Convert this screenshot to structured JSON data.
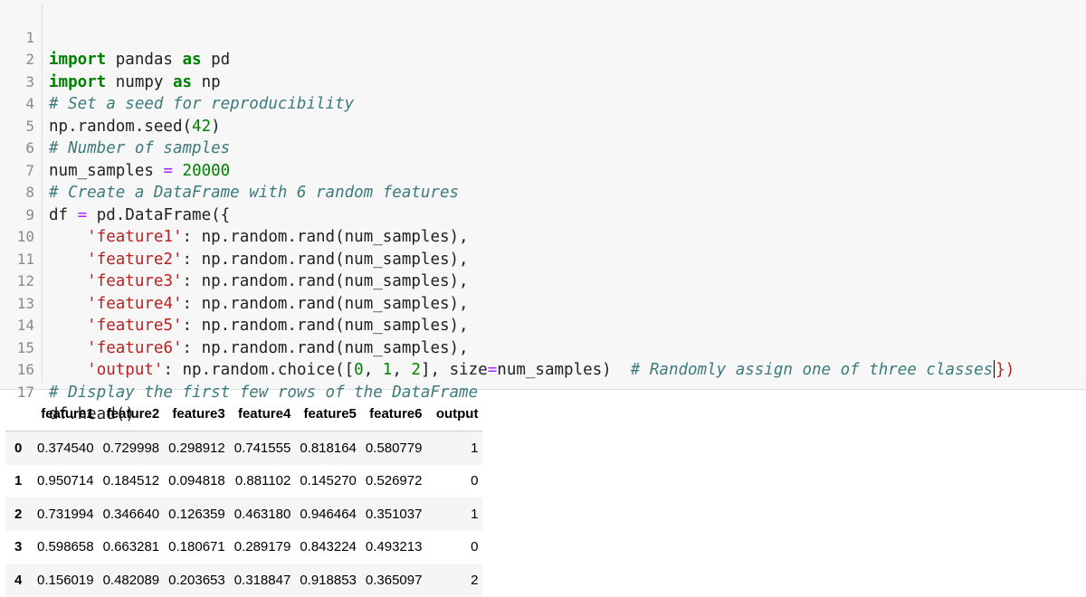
{
  "code_cell": {
    "line_numbers": [
      "1",
      "2",
      "3",
      "4",
      "5",
      "6",
      "7",
      "8",
      "9",
      "10",
      "11",
      "12",
      "13",
      "14",
      "15",
      "16",
      "17"
    ],
    "l1": {
      "kw1": "import",
      "t1": " pandas ",
      "kw2": "as",
      "t2": " pd"
    },
    "l2": {
      "kw1": "import",
      "t1": " numpy ",
      "kw2": "as",
      "t2": " np"
    },
    "l3": {
      "comment": "# Set a seed for reproducibility"
    },
    "l4": {
      "t1": "np.random.seed(",
      "num": "42",
      "t2": ")"
    },
    "l5": {
      "comment": "# Number of samples"
    },
    "l6": {
      "t1": "num_samples ",
      "op": "=",
      "t2": " ",
      "num": "20000"
    },
    "l7": {
      "comment": "# Create a DataFrame with 6 random features"
    },
    "l8": {
      "t1": "df ",
      "op": "=",
      "t2": " pd.DataFrame({"
    },
    "l9": {
      "indent": "    ",
      "str": "'feature1'",
      "t": ": np.random.rand(num_samples),"
    },
    "l10": {
      "indent": "    ",
      "str": "'feature2'",
      "t": ": np.random.rand(num_samples),"
    },
    "l11": {
      "indent": "    ",
      "str": "'feature3'",
      "t": ": np.random.rand(num_samples),"
    },
    "l12": {
      "indent": "    ",
      "str": "'feature4'",
      "t": ": np.random.rand(num_samples),"
    },
    "l13": {
      "indent": "    ",
      "str": "'feature5'",
      "t": ": np.random.rand(num_samples),"
    },
    "l14": {
      "indent": "    ",
      "str": "'feature6'",
      "t": ": np.random.rand(num_samples),"
    },
    "l15": {
      "indent": "    ",
      "str": "'output'",
      "t1": ": np.random.choice([",
      "n0": "0",
      "c1": ", ",
      "n1": "1",
      "c2": ", ",
      "n2": "2",
      "t2": "], size",
      "op": "=",
      "t3": "num_samples)  ",
      "comment": "# Randomly assign one of three classes",
      "close": "})"
    },
    "l16": {
      "comment": "# Display the first few rows of the DataFrame"
    },
    "l17": {
      "t1": "df.head()"
    }
  },
  "output_table": {
    "columns": [
      "feature1",
      "feature2",
      "feature3",
      "feature4",
      "feature5",
      "feature6",
      "output"
    ],
    "rows": [
      {
        "index": "0",
        "cells": [
          "0.374540",
          "0.729998",
          "0.298912",
          "0.741555",
          "0.818164",
          "0.580779",
          "1"
        ]
      },
      {
        "index": "1",
        "cells": [
          "0.950714",
          "0.184512",
          "0.094818",
          "0.881102",
          "0.145270",
          "0.526972",
          "0"
        ]
      },
      {
        "index": "2",
        "cells": [
          "0.731994",
          "0.346640",
          "0.126359",
          "0.463180",
          "0.946464",
          "0.351037",
          "1"
        ]
      },
      {
        "index": "3",
        "cells": [
          "0.598658",
          "0.663281",
          "0.180671",
          "0.289179",
          "0.843224",
          "0.493213",
          "0"
        ]
      },
      {
        "index": "4",
        "cells": [
          "0.156019",
          "0.482089",
          "0.203653",
          "0.318847",
          "0.918853",
          "0.365097",
          "2"
        ]
      }
    ]
  }
}
